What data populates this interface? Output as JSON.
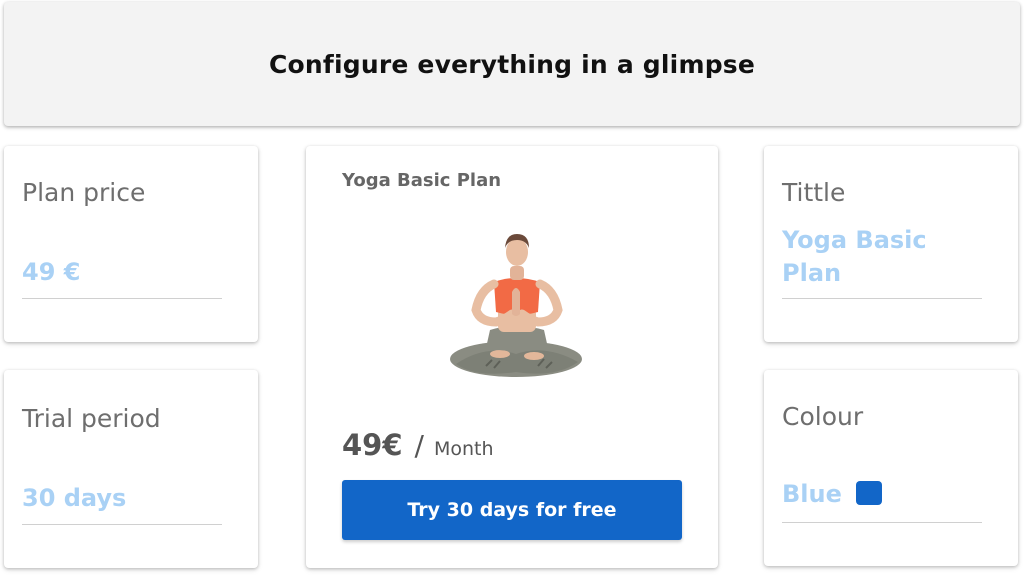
{
  "header": {
    "title": "Configure everything in a glimpse"
  },
  "plan_price": {
    "label": "Plan price",
    "value": "49 €"
  },
  "trial_period": {
    "label": "Trial period",
    "value": "30 days"
  },
  "preview": {
    "plan_name": "Yoga Basic Plan",
    "price": "49€",
    "separator": "/",
    "period": "Month",
    "cta_label": "Try 30 days for free",
    "image": "woman-meditating-lotus-pose"
  },
  "title_field": {
    "label": "Tittle",
    "value": "Yoga Basic Plan"
  },
  "colour_field": {
    "label": "Colour",
    "value": "Blue",
    "swatch_color": "#1266c8"
  },
  "colors": {
    "accent": "#1266c8",
    "value_text": "#a9d1f5",
    "label_text": "#6e6e6e"
  }
}
